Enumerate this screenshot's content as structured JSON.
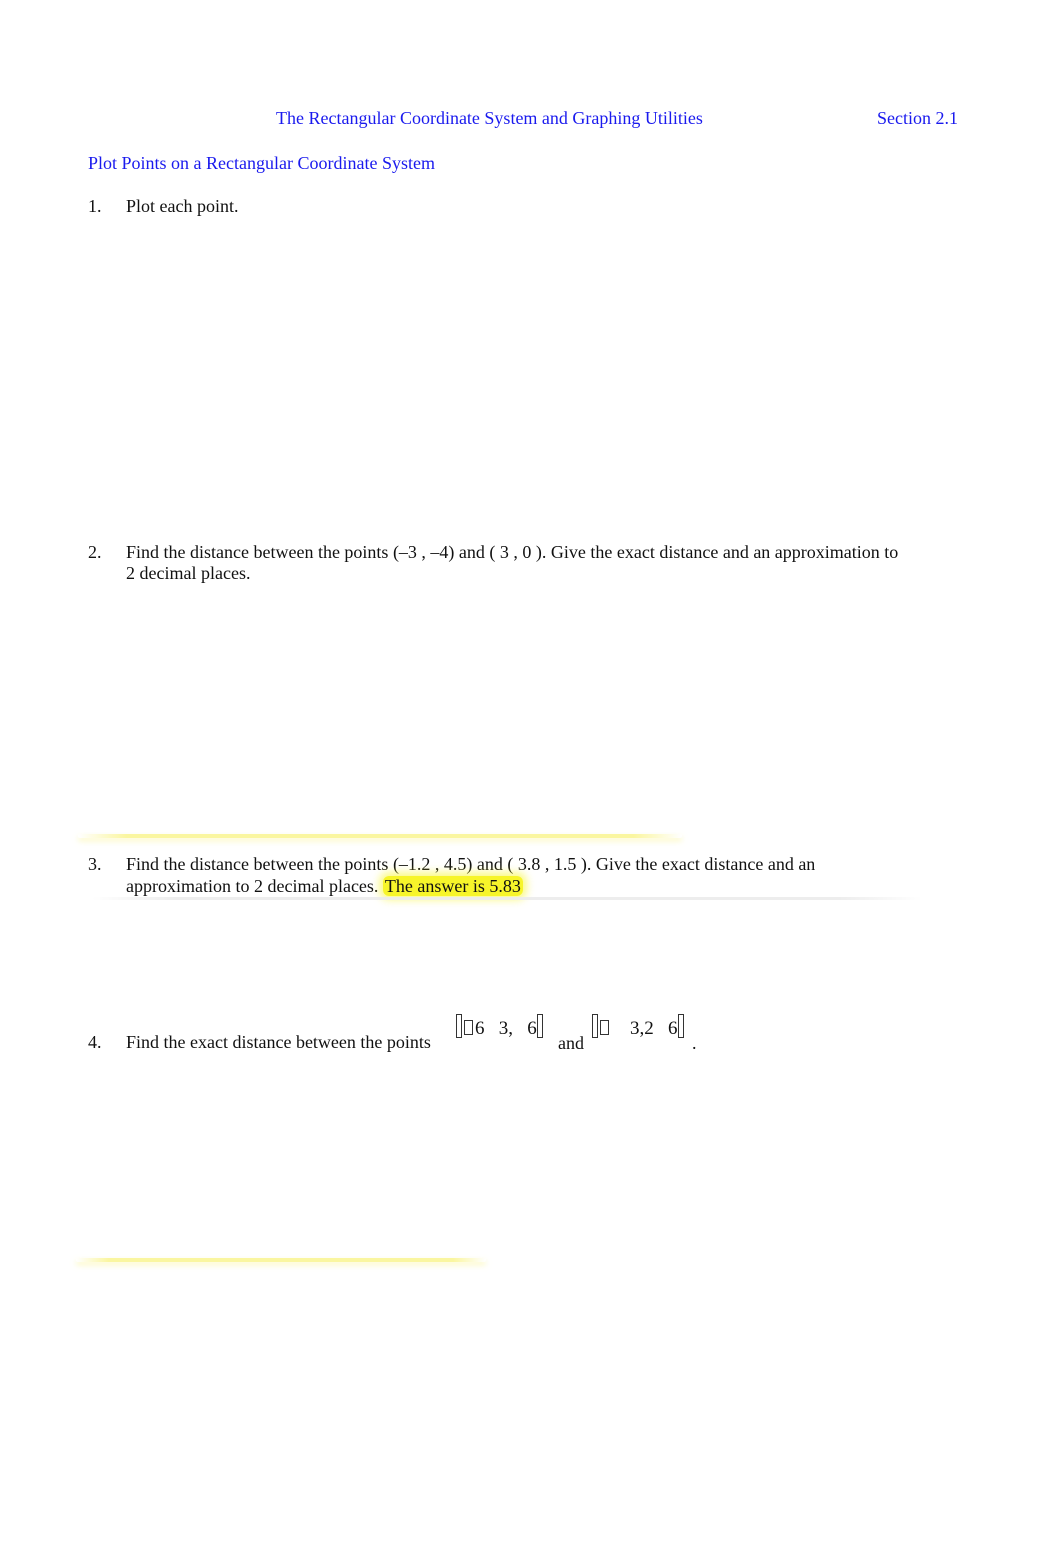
{
  "header": {
    "title": "The Rectangular Coordinate System and Graphing Utilities",
    "section": "Section 2.1"
  },
  "subheading": "Plot Points on a Rectangular Coordinate System",
  "problems": [
    {
      "number": "1.",
      "line1": "Plot each point."
    },
    {
      "number": "2.",
      "line1": "Find the distance between the points  (–3 , –4) and ( 3 , 0 ). Give the exact distance and an approximation to",
      "line2": "2 decimal places."
    },
    {
      "number": "3.",
      "line1": "Find the distance between the points  (–1.2 , 4.5) and ( 3.8 , 1.5 ). Give the exact distance and an",
      "line2": "approximation to 2 decimal places. ",
      "answer": "The answer is 5.83"
    },
    {
      "number": "4.",
      "line1": "Find the exact distance between the points",
      "point1_a": "6",
      "point1_b": "3,",
      "point1_c": "6",
      "and": "and",
      "point2_a": "3,2",
      "point2_b": "6",
      "end": "."
    }
  ],
  "colors": {
    "heading": "#1a1aee",
    "highlight": "#f7f52a",
    "text": "#111111"
  }
}
